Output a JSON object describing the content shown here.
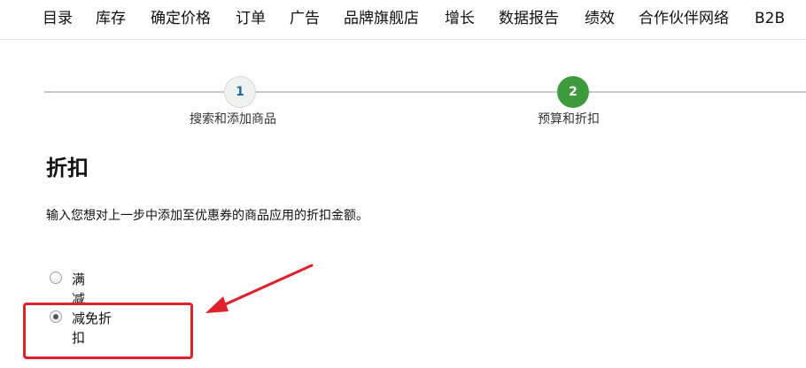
{
  "nav": {
    "items": [
      "目录",
      "库存",
      "确定价格",
      "订单",
      "广告",
      "品牌旗舰店",
      "增长",
      "数据报告",
      "绩效",
      "合作伙伴网络",
      "B2B"
    ]
  },
  "stepper": {
    "steps": [
      {
        "number": "1",
        "label": "搜索和添加商品",
        "state": "completed"
      },
      {
        "number": "2",
        "label": "预算和折扣",
        "state": "active"
      }
    ]
  },
  "section": {
    "title": "折扣",
    "description": "输入您想对上一步中添加至优惠券的商品应用的折扣金额。"
  },
  "discount_options": [
    {
      "label": "满减",
      "selected": false
    },
    {
      "label": "减免折扣",
      "selected": true
    }
  ],
  "colors": {
    "active_step": "#3d9a3d",
    "annotation": "#e0202a"
  }
}
